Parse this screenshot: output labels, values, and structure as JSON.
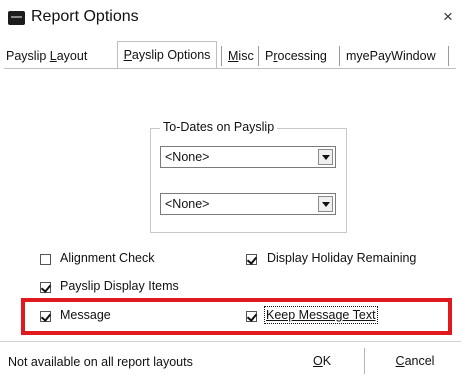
{
  "window": {
    "title": "Report Options",
    "close_glyph": "×",
    "icon": "app-icon"
  },
  "tabs": [
    {
      "label_pre": "Payslip ",
      "accel": "L",
      "label_post": "ayout",
      "active": false
    },
    {
      "label_pre": "",
      "accel": "P",
      "label_post": "ayslip Options",
      "active": true
    },
    {
      "label_pre": "",
      "accel": "M",
      "label_post": "isc",
      "active": false
    },
    {
      "label_pre": "P",
      "accel": "r",
      "label_post": "ocessing",
      "active": false
    },
    {
      "label_pre": "myePayWindow",
      "accel": "",
      "label_post": "",
      "active": false
    }
  ],
  "todates": {
    "group_title": "To-Dates on Payslip",
    "combo1_value": "<None>",
    "combo2_value": "<None>"
  },
  "options": {
    "alignment_check": {
      "label": "Alignment Check",
      "checked": false
    },
    "display_holiday": {
      "label": "Display Holiday Remaining",
      "checked": true
    },
    "payslip_display": {
      "label": "Payslip Display Items",
      "checked": true
    },
    "message": {
      "label": "Message",
      "checked": true
    },
    "keep_message": {
      "label": "Keep Message Text",
      "checked": true
    }
  },
  "footer": {
    "status_text": "Not available on all report layouts",
    "ok_accel": "O",
    "ok_rest": "K",
    "cancel_accel": "C",
    "cancel_rest": "ancel"
  },
  "colors": {
    "highlight": "#e0191f",
    "text": "#111111",
    "border": "#bfbfbf"
  }
}
